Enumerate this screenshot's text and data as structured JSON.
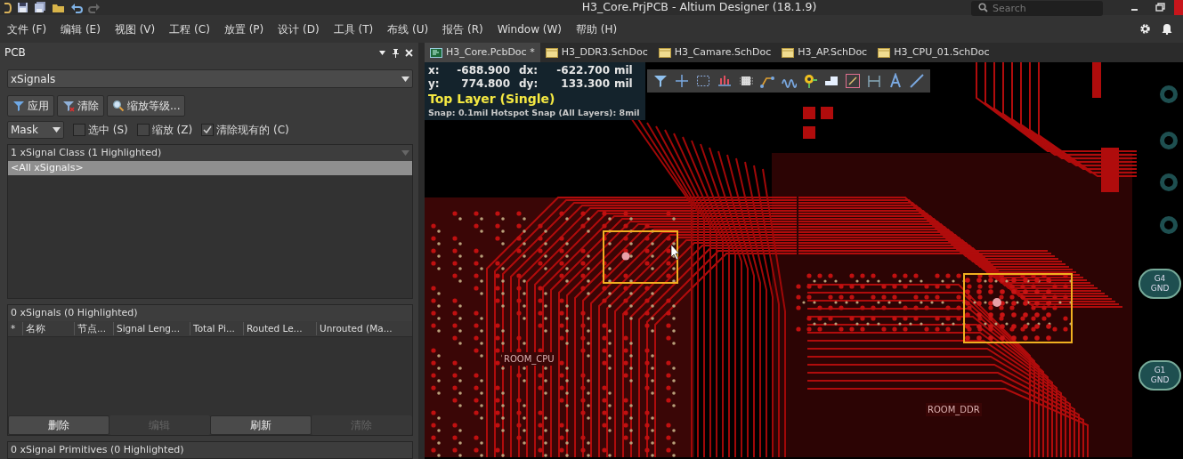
{
  "window": {
    "title": "H3_Core.PrjPCB - Altium Designer (18.1.9)"
  },
  "search": {
    "placeholder": "Search"
  },
  "menu": [
    "文件 (F)",
    "编辑 (E)",
    "视图 (V)",
    "工程 (C)",
    "放置 (P)",
    "设计 (D)",
    "工具 (T)",
    "布线 (U)",
    "报告 (R)",
    "Window (W)",
    "帮助 (H)"
  ],
  "panel": {
    "title": "PCB",
    "mode": "xSignals",
    "filter_buttons": [
      {
        "label": "应用",
        "kind": "funnel"
      },
      {
        "label": "清除",
        "kind": "funnel-clear"
      },
      {
        "label": "缩放等级...",
        "kind": "magnifier"
      }
    ],
    "mask": "Mask",
    "options": [
      {
        "label": "选中 (S)",
        "checked": false
      },
      {
        "label": "缩放 (Z)",
        "checked": false
      },
      {
        "label": "清除现有的 (C)",
        "checked": true
      }
    ],
    "class_list": {
      "header": "1 xSignal Class (1 Highlighted)",
      "items": [
        {
          "label": "<All xSignals>",
          "selected": true
        }
      ]
    },
    "signals": {
      "header": "0 xSignals (0 Highlighted)",
      "columns": [
        "*",
        "名称",
        "节点...",
        "Signal Leng...",
        "Total Pi...",
        "Routed Le...",
        "Unrouted (Ma..."
      ],
      "buttons": [
        {
          "label": "删除",
          "disabled": false
        },
        {
          "label": "编辑",
          "disabled": true
        },
        {
          "label": "刷新",
          "disabled": false
        },
        {
          "label": "清除",
          "disabled": true
        }
      ]
    },
    "primitives": {
      "header": "0 xSignal Primitives (0 Highlighted)"
    }
  },
  "tabs": [
    {
      "label": "H3_Core.PcbDoc *",
      "kind": "pcb",
      "selected": true
    },
    {
      "label": "H3_DDR3.SchDoc",
      "kind": "sch",
      "selected": false
    },
    {
      "label": "H3_Camare.SchDoc",
      "kind": "sch",
      "selected": false
    },
    {
      "label": "H3_AP.SchDoc",
      "kind": "sch",
      "selected": false
    },
    {
      "label": "H3_CPU_01.SchDoc",
      "kind": "sch",
      "selected": false
    }
  ],
  "readout": {
    "lines": [
      {
        "axis": "x:",
        "value": "-688.900",
        "delta_axis": "dx:",
        "delta": "-622.700",
        "unit": "mil"
      },
      {
        "axis": "y:",
        "value": "774.800",
        "delta_axis": "dy:",
        "delta": "133.300",
        "unit": "mil"
      }
    ],
    "layer": "Top Layer (Single)",
    "snap": "Snap: 0.1mil Hotspot Snap (All Layers): 8mil"
  },
  "board": {
    "rooms": [
      "ROOM_CPU",
      "ROOM_DDR"
    ],
    "pads": [
      {
        "line1": "G4",
        "line2": "GND"
      },
      {
        "line1": "G1",
        "line2": "GND"
      }
    ]
  }
}
